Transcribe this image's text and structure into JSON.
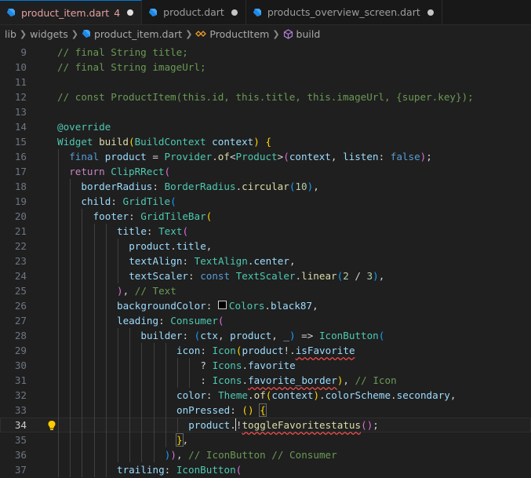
{
  "tabs": [
    {
      "label": "product_item.dart",
      "problems": "4",
      "active": true
    },
    {
      "label": "product.dart",
      "active": false
    },
    {
      "label": "products_overview_screen.dart",
      "active": false
    }
  ],
  "breadcrumb": {
    "items": [
      "lib",
      "widgets",
      "product_item.dart",
      "ProductItem",
      "build"
    ]
  },
  "icons": {
    "file": "dart-file-icon",
    "class": "class-symbol-icon",
    "method": "method-symbol-icon",
    "lightbulb": "lightbulb-icon",
    "modified": "unsaved-dot-icon"
  },
  "colors": {
    "comment": "#6a9955",
    "keyword": "#569cd6",
    "control": "#c586c0",
    "type": "#4ec9b0",
    "function": "#dcdcaa",
    "variable": "#9cdcfe",
    "number": "#b5cea8"
  },
  "editor": {
    "current_line": "34",
    "lines": [
      {
        "n": "9",
        "indent": 0,
        "tokens": [
          [
            "cm",
            "// final String title;"
          ]
        ]
      },
      {
        "n": "10",
        "indent": 0,
        "tokens": [
          [
            "cm",
            "// final String imageUrl;"
          ]
        ]
      },
      {
        "n": "11",
        "indent": 0,
        "tokens": []
      },
      {
        "n": "12",
        "indent": 0,
        "tokens": [
          [
            "cm",
            "// const ProductItem(this.id, this.title, this.imageUrl, {super.key});"
          ]
        ]
      },
      {
        "n": "13",
        "indent": 0,
        "tokens": []
      },
      {
        "n": "14",
        "indent": 0,
        "tokens": [
          [
            "ty",
            "@override"
          ]
        ]
      },
      {
        "n": "15",
        "indent": 0,
        "tokens": [
          [
            "ty",
            "Widget "
          ],
          [
            "fn",
            "build"
          ],
          [
            "p1",
            "("
          ],
          [
            "ty",
            "BuildContext "
          ],
          [
            "vr",
            "context"
          ],
          [
            "p1",
            ")"
          ],
          [
            "pl",
            " "
          ],
          [
            "p1",
            "{"
          ]
        ]
      },
      {
        "n": "16",
        "indent": 1,
        "tokens": [
          [
            "kw",
            "final "
          ],
          [
            "vr",
            "product"
          ],
          [
            "pl",
            " = "
          ],
          [
            "ty",
            "Provider"
          ],
          [
            "pl",
            "."
          ],
          [
            "fn",
            "of"
          ],
          [
            "pl",
            "<"
          ],
          [
            "ty",
            "Product"
          ],
          [
            "pl",
            ">"
          ],
          [
            "p2",
            "("
          ],
          [
            "vr",
            "context"
          ],
          [
            "pl",
            ", "
          ],
          [
            "vr",
            "listen"
          ],
          [
            "pl",
            ": "
          ],
          [
            "kw",
            "false"
          ],
          [
            "p2",
            ")"
          ],
          [
            "pl",
            ";"
          ]
        ]
      },
      {
        "n": "17",
        "indent": 1,
        "tokens": [
          [
            "ctl",
            "return "
          ],
          [
            "ty",
            "ClipRRect"
          ],
          [
            "p2",
            "("
          ]
        ]
      },
      {
        "n": "18",
        "indent": 2,
        "tokens": [
          [
            "vr",
            "borderRadius"
          ],
          [
            "pl",
            ": "
          ],
          [
            "ty",
            "BorderRadius"
          ],
          [
            "pl",
            "."
          ],
          [
            "fn",
            "circular"
          ],
          [
            "p3",
            "("
          ],
          [
            "nm",
            "10"
          ],
          [
            "p3",
            ")"
          ],
          [
            "pl",
            ","
          ]
        ]
      },
      {
        "n": "19",
        "indent": 2,
        "tokens": [
          [
            "vr",
            "child"
          ],
          [
            "pl",
            ": "
          ],
          [
            "ty",
            "GridTile"
          ],
          [
            "p3",
            "("
          ]
        ]
      },
      {
        "n": "20",
        "indent": 3,
        "tokens": [
          [
            "vr",
            "footer"
          ],
          [
            "pl",
            ": "
          ],
          [
            "ty",
            "GridTileBar"
          ],
          [
            "p1",
            "("
          ]
        ]
      },
      {
        "n": "21",
        "indent": 5,
        "tokens": [
          [
            "vr",
            "title"
          ],
          [
            "pl",
            ": "
          ],
          [
            "ty",
            "Text"
          ],
          [
            "p2",
            "("
          ]
        ]
      },
      {
        "n": "22",
        "indent": 6,
        "tokens": [
          [
            "vr",
            "product"
          ],
          [
            "pl",
            "."
          ],
          [
            "vr",
            "title"
          ],
          [
            "pl",
            ","
          ]
        ]
      },
      {
        "n": "23",
        "indent": 6,
        "tokens": [
          [
            "vr",
            "textAlign"
          ],
          [
            "pl",
            ": "
          ],
          [
            "ty",
            "TextAlign"
          ],
          [
            "pl",
            "."
          ],
          [
            "vr",
            "center"
          ],
          [
            "pl",
            ","
          ]
        ]
      },
      {
        "n": "24",
        "indent": 6,
        "tokens": [
          [
            "vr",
            "textScaler"
          ],
          [
            "pl",
            ": "
          ],
          [
            "kw",
            "const "
          ],
          [
            "ty",
            "TextScaler"
          ],
          [
            "pl",
            "."
          ],
          [
            "fn",
            "linear"
          ],
          [
            "p3",
            "("
          ],
          [
            "nm",
            "2"
          ],
          [
            "pl",
            " / "
          ],
          [
            "nm",
            "3"
          ],
          [
            "p3",
            ")"
          ],
          [
            "pl",
            ","
          ]
        ]
      },
      {
        "n": "25",
        "indent": 5,
        "tokens": [
          [
            "p2",
            ")"
          ],
          [
            "pl",
            ", "
          ],
          [
            "cm",
            "// Text"
          ]
        ]
      },
      {
        "n": "26",
        "indent": 5,
        "tokens": [
          [
            "vr",
            "backgroundColor"
          ],
          [
            "pl",
            ": "
          ],
          [
            "swatch",
            ""
          ],
          [
            "ty",
            "Colors"
          ],
          [
            "pl",
            "."
          ],
          [
            "vr",
            "black87"
          ],
          [
            "pl",
            ","
          ]
        ]
      },
      {
        "n": "27",
        "indent": 5,
        "tokens": [
          [
            "vr",
            "leading"
          ],
          [
            "pl",
            ": "
          ],
          [
            "ty",
            "Consumer"
          ],
          [
            "p2",
            "("
          ]
        ]
      },
      {
        "n": "28",
        "indent": 7,
        "tokens": [
          [
            "vr",
            "builder"
          ],
          [
            "pl",
            ": "
          ],
          [
            "p3",
            "("
          ],
          [
            "vr",
            "ctx"
          ],
          [
            "pl",
            ", "
          ],
          [
            "vr",
            "product"
          ],
          [
            "pl",
            ", "
          ],
          [
            "vr",
            "_"
          ],
          [
            "p3",
            ")"
          ],
          [
            "pl",
            " => "
          ],
          [
            "ty",
            "IconButton"
          ],
          [
            "p3",
            "("
          ]
        ]
      },
      {
        "n": "29",
        "indent": 10,
        "tokens": [
          [
            "vr",
            "icon"
          ],
          [
            "pl",
            ": "
          ],
          [
            "ty",
            "Icon"
          ],
          [
            "p1",
            "("
          ],
          [
            "vr",
            "product"
          ],
          [
            "pl",
            "!."
          ],
          [
            "vrsq",
            "isFavorite"
          ]
        ]
      },
      {
        "n": "30",
        "indent": 12,
        "tokens": [
          [
            "pl",
            "? "
          ],
          [
            "ty",
            "Icons"
          ],
          [
            "pl",
            "."
          ],
          [
            "vr",
            "favorite"
          ]
        ]
      },
      {
        "n": "31",
        "indent": 12,
        "tokens": [
          [
            "pl",
            ": "
          ],
          [
            "ty",
            "Icons"
          ],
          [
            "pl",
            "."
          ],
          [
            "vrsq",
            "favorite_border"
          ],
          [
            "p1",
            ")"
          ],
          [
            "pl",
            ", "
          ],
          [
            "cm",
            "// Icon"
          ]
        ]
      },
      {
        "n": "32",
        "indent": 10,
        "tokens": [
          [
            "vr",
            "color"
          ],
          [
            "pl",
            ": "
          ],
          [
            "ty",
            "Theme"
          ],
          [
            "pl",
            "."
          ],
          [
            "fn",
            "of"
          ],
          [
            "p1",
            "("
          ],
          [
            "vr",
            "context"
          ],
          [
            "p1",
            ")"
          ],
          [
            "pl",
            "."
          ],
          [
            "vr",
            "colorScheme"
          ],
          [
            "pl",
            "."
          ],
          [
            "vr",
            "secondary"
          ],
          [
            "pl",
            ","
          ]
        ]
      },
      {
        "n": "33",
        "indent": 10,
        "tokens": [
          [
            "vr",
            "onPressed"
          ],
          [
            "pl",
            ": "
          ],
          [
            "p1",
            "()"
          ],
          [
            "pl",
            " "
          ],
          [
            "p1box",
            "{"
          ]
        ]
      },
      {
        "n": "34",
        "indent": 11,
        "tokens": [
          [
            "vr",
            "product"
          ],
          [
            "pl",
            "."
          ],
          [
            "cursor",
            ""
          ],
          [
            "pl",
            "!"
          ],
          [
            "fnsq",
            "toggleFavoritestatus"
          ],
          [
            "p2",
            "()"
          ],
          [
            "pl",
            ";"
          ]
        ]
      },
      {
        "n": "35",
        "indent": 10,
        "tokens": [
          [
            "p1box",
            "}"
          ],
          [
            "pl",
            ","
          ]
        ]
      },
      {
        "n": "36",
        "indent": 9,
        "tokens": [
          [
            "p3",
            ")"
          ],
          [
            "p2",
            ")"
          ],
          [
            "pl",
            ", "
          ],
          [
            "cm",
            "// IconButton // Consumer"
          ]
        ]
      },
      {
        "n": "37",
        "indent": 5,
        "tokens": [
          [
            "vr",
            "trailing"
          ],
          [
            "pl",
            ": "
          ],
          [
            "ty",
            "IconButton"
          ],
          [
            "p2",
            "("
          ]
        ]
      }
    ]
  }
}
